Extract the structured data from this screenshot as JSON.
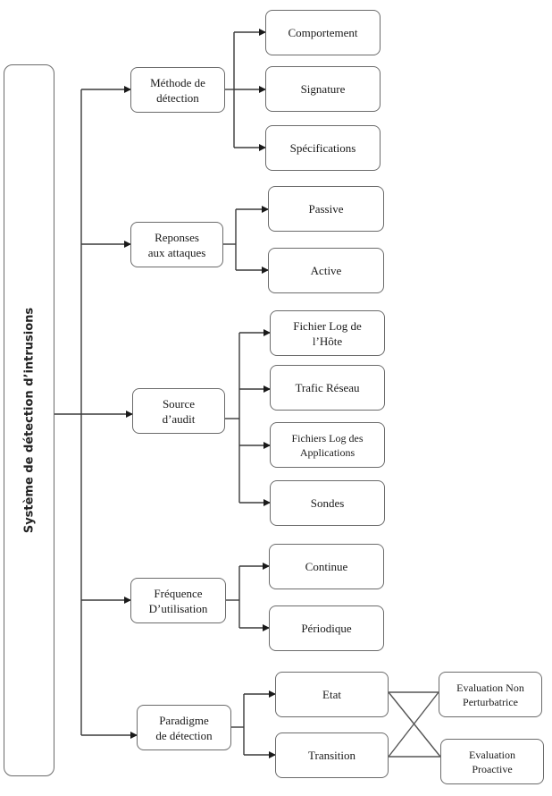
{
  "root": {
    "label": "Système de détection d’intrusions"
  },
  "categories": [
    {
      "label": "Méthode de\ndétection",
      "children": [
        "Comportement",
        "Signature",
        "Spécifications"
      ]
    },
    {
      "label": "Reponses\naux attaques",
      "children": [
        "Passive",
        "Active"
      ]
    },
    {
      "label": "Source\nd’audit",
      "children": [
        "Fichier Log de\nl’Hôte",
        "Trafic Réseau",
        "Fichiers Log des\nApplications",
        "Sondes"
      ]
    },
    {
      "label": "Fréquence\nD’utilisation",
      "children": [
        "Continue",
        "Périodique"
      ]
    },
    {
      "label": "Paradigme\nde détection",
      "children": [
        "Etat",
        "Transition"
      ],
      "evaluations": [
        "Evaluation Non\nPerturbatrice",
        "Evaluation\nProactive"
      ]
    }
  ],
  "colors": {
    "line": "#3a3a3a",
    "border": "#6b6b6b",
    "text": "#1a1a1a"
  }
}
